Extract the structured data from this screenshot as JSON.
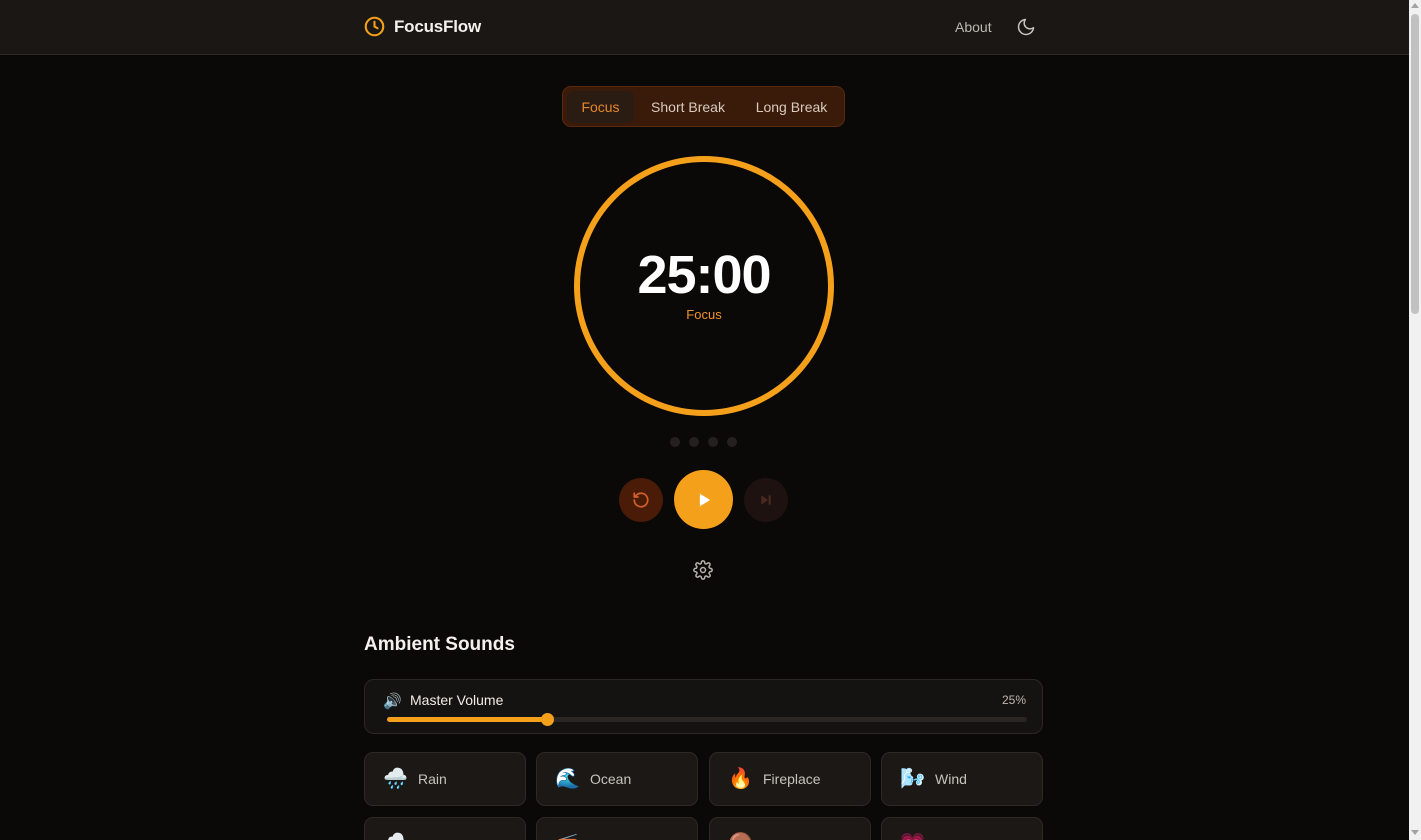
{
  "app": {
    "name": "FocusFlow"
  },
  "header": {
    "about_label": "About"
  },
  "modes": [
    {
      "label": "Focus",
      "active": true
    },
    {
      "label": "Short Break",
      "active": false
    },
    {
      "label": "Long Break",
      "active": false
    }
  ],
  "timer": {
    "time": "25:00",
    "mode_label": "Focus",
    "progress": 1.0,
    "sessions_total": 4,
    "sessions_done": 0
  },
  "controls": {
    "reset_icon": "rotate-ccw-icon",
    "play_icon": "play-icon",
    "skip_icon": "skip-forward-icon",
    "settings_icon": "gear-icon"
  },
  "ambient": {
    "title": "Ambient Sounds",
    "master_volume": {
      "label": "Master Volume",
      "value_text": "25%",
      "value": 0.25
    },
    "sounds": [
      {
        "label": "Rain",
        "icon": "🌧️"
      },
      {
        "label": "Ocean",
        "icon": "🌊"
      },
      {
        "label": "Fireplace",
        "icon": "🔥"
      },
      {
        "label": "Wind",
        "icon": "🌬️"
      },
      {
        "label": "",
        "icon": "⛈️"
      },
      {
        "label": "",
        "icon": "📻"
      },
      {
        "label": "",
        "icon": "🟤"
      },
      {
        "label": "",
        "icon": "💗"
      }
    ]
  },
  "colors": {
    "accent": "#f5a01a",
    "accent_text": "#e8862a",
    "background": "#0b0908",
    "header": "#1a1715"
  }
}
